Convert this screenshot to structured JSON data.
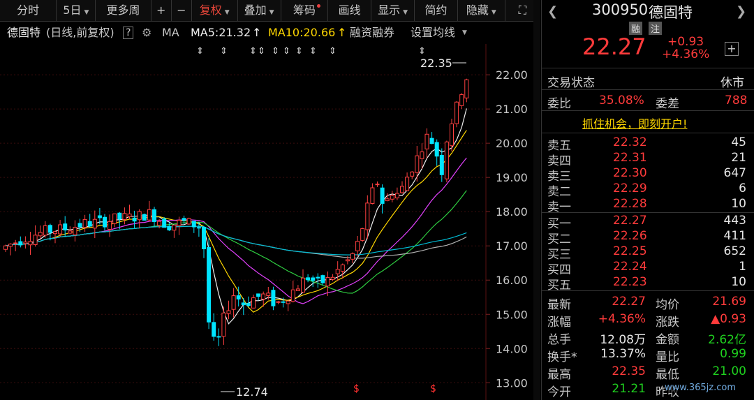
{
  "toolbar": {
    "items": [
      {
        "label": "分时",
        "has_arrow": false
      },
      {
        "label": "5日",
        "has_arrow": true
      },
      {
        "label": "更多周",
        "has_arrow": false
      },
      {
        "label": "+",
        "has_arrow": false
      },
      {
        "label": "−",
        "has_arrow": false
      },
      {
        "label": "复权",
        "has_arrow": true,
        "active": true
      },
      {
        "label": "叠加",
        "has_arrow": true
      },
      {
        "label": "筹码",
        "has_arrow": false,
        "dot": true
      },
      {
        "label": "画线",
        "has_arrow": false
      },
      {
        "label": "显示",
        "has_arrow": true
      },
      {
        "label": "简约",
        "has_arrow": false
      },
      {
        "label": "隐藏",
        "has_arrow": true
      },
      {
        "label": "⛶",
        "has_arrow": false
      }
    ]
  },
  "infobar": {
    "stock_name": "德固特",
    "period": "(日线,前复权)",
    "help": "?",
    "ma_label": "MA",
    "ma5": "MA5:21.32",
    "ma10": "MA10:20.66",
    "rong": "融资融券",
    "settings": "设置均线"
  },
  "chart_data": {
    "type": "candlestick",
    "y_ticks": [
      "22.00",
      "21.00",
      "20.00",
      "19.00",
      "18.00",
      "17.00",
      "16.00",
      "15.00",
      "14.00",
      "13.00"
    ],
    "ylim": [
      12.7,
      22.9
    ],
    "high_marker": "22.35",
    "low_marker": "12.74",
    "colors": {
      "up": "#ff4040",
      "down": "#00e5ff",
      "ma5": "#f0f0f0",
      "ma10": "#ffd700",
      "ma20": "#e040fb",
      "ma30": "#2ecc40",
      "ma60": "#b0b0b0",
      "ma120": "#00bcd4"
    }
  },
  "quote": {
    "code": "300950",
    "name": "德固特",
    "tag1": "融",
    "tag2": "注",
    "price": "22.27",
    "change": "+0.93",
    "pct": "+4.36%",
    "trade_status_label": "交易状态",
    "trade_status": "休市",
    "weibi_label": "委比",
    "weibi": "35.08%",
    "weicha_label": "委差",
    "weicha": "788",
    "ad": "抓住机会，即刻开户!",
    "asks": [
      {
        "label": "卖五",
        "price": "22.32",
        "vol": "45"
      },
      {
        "label": "卖四",
        "price": "22.31",
        "vol": "21"
      },
      {
        "label": "卖三",
        "price": "22.30",
        "vol": "647"
      },
      {
        "label": "卖二",
        "price": "22.29",
        "vol": "6"
      },
      {
        "label": "卖一",
        "price": "22.28",
        "vol": "10"
      }
    ],
    "bids": [
      {
        "label": "买一",
        "price": "22.27",
        "vol": "443"
      },
      {
        "label": "买二",
        "price": "22.26",
        "vol": "411"
      },
      {
        "label": "买三",
        "price": "22.25",
        "vol": "652"
      },
      {
        "label": "买四",
        "price": "22.24",
        "vol": "1"
      },
      {
        "label": "买五",
        "price": "22.23",
        "vol": "10"
      }
    ],
    "stats": [
      {
        "l1": "最新",
        "v1": "22.27",
        "c1": "red",
        "l2": "均价",
        "v2": "21.69",
        "c2": "red"
      },
      {
        "l1": "涨幅",
        "v1": "+4.36%",
        "c1": "red",
        "l2": "涨跌",
        "v2": "▲0.93",
        "c2": "red"
      },
      {
        "l1": "总手",
        "v1": "12.08万",
        "c1": "white",
        "l2": "金额",
        "v2": "2.62亿",
        "c2": "green"
      },
      {
        "l1": "换手*",
        "v1": "13.37%",
        "c1": "white",
        "l2": "量比",
        "v2": "0.99",
        "c2": "green"
      },
      {
        "l1": "最高",
        "v1": "22.35",
        "c1": "red",
        "l2": "最低",
        "v2": "21.00",
        "c2": "green"
      },
      {
        "l1": "今开",
        "v1": "21.21",
        "c1": "green",
        "l2": "昨收",
        "v2": "",
        "c2": "white"
      }
    ],
    "watermark": "www.365jz.com"
  }
}
